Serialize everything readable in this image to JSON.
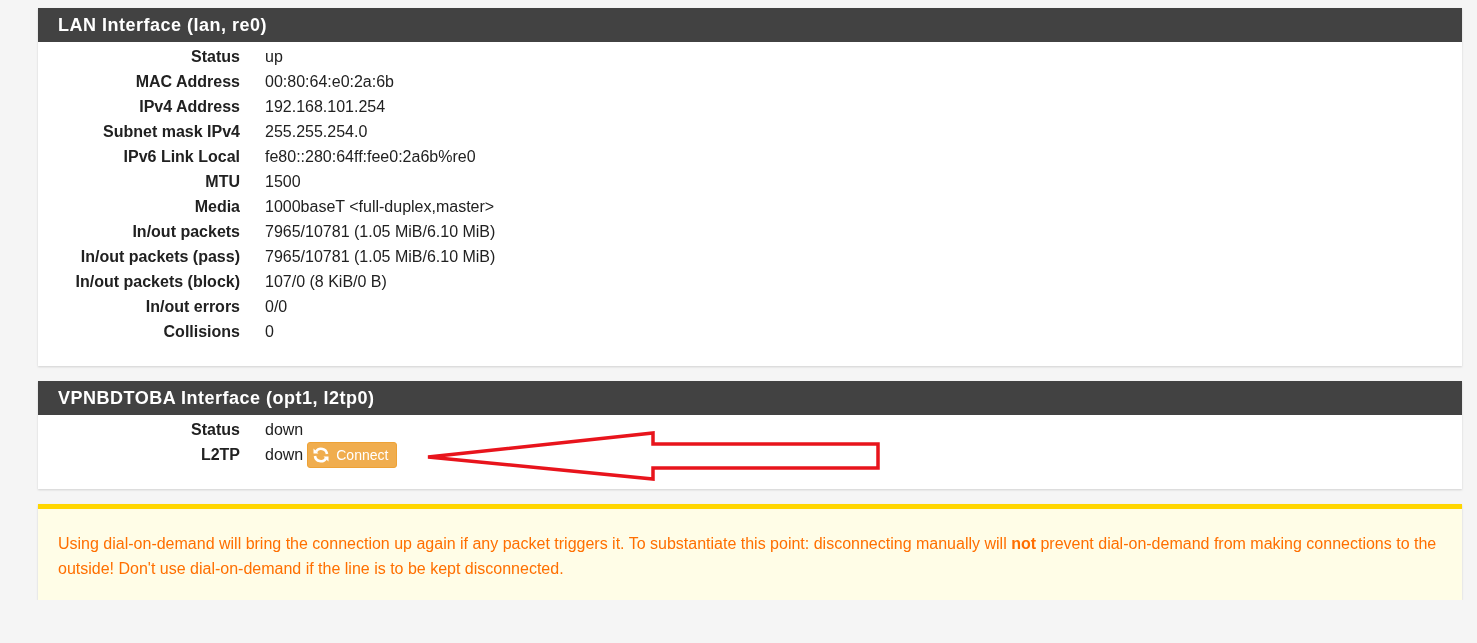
{
  "panels": [
    {
      "title": "LAN Interface (lan, re0)",
      "rows": [
        {
          "label": "Status",
          "value": "up"
        },
        {
          "label": "MAC Address",
          "value": "00:80:64:e0:2a:6b"
        },
        {
          "label": "IPv4 Address",
          "value": "192.168.101.254"
        },
        {
          "label": "Subnet mask IPv4",
          "value": "255.255.254.0"
        },
        {
          "label": "IPv6 Link Local",
          "value": "fe80::280:64ff:fee0:2a6b%re0"
        },
        {
          "label": "MTU",
          "value": "1500"
        },
        {
          "label": "Media",
          "value": "1000baseT <full-duplex,master>"
        },
        {
          "label": "In/out packets",
          "value": "7965/10781 (1.05 MiB/6.10 MiB)"
        },
        {
          "label": "In/out packets (pass)",
          "value": "7965/10781 (1.05 MiB/6.10 MiB)"
        },
        {
          "label": "In/out packets (block)",
          "value": "107/0 (8 KiB/0 B)"
        },
        {
          "label": "In/out errors",
          "value": "0/0"
        },
        {
          "label": "Collisions",
          "value": "0"
        }
      ]
    },
    {
      "title": "VPNBDTOBA Interface (opt1, l2tp0)",
      "rows": [
        {
          "label": "Status",
          "value": "down"
        },
        {
          "label": "L2TP",
          "value": "down",
          "button": "Connect"
        }
      ]
    }
  ],
  "alert": {
    "text": "Using dial-on-demand will bring the connection up again if any packet triggers it. To substantiate this point: disconnecting manually will **not** prevent dial-on-demand from making connections to the outside! Don't use dial-on-demand if the line is to be kept disconnected."
  }
}
